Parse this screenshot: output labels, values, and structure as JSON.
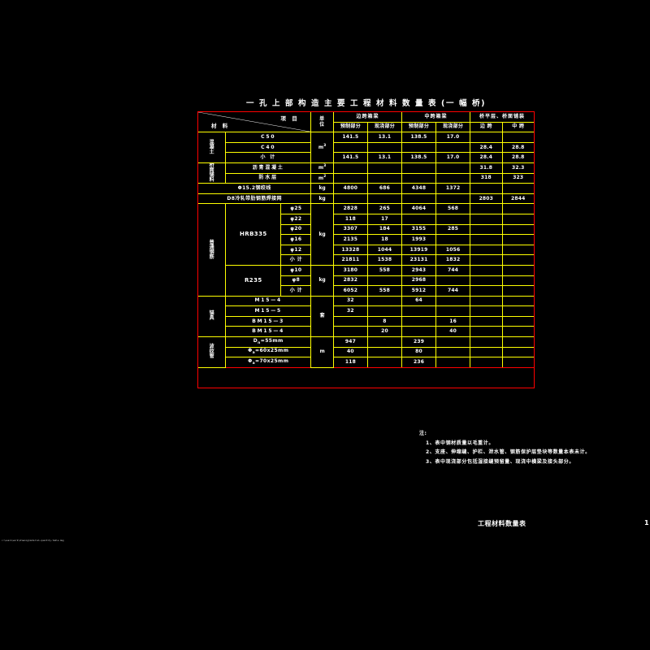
{
  "title": "一 孔 上 部 构 造 主 要 工 程 材 料 数 量 表 (一 幅 桥)",
  "header": {
    "corner_item": "项 目",
    "corner_material": "材 料",
    "unit": "单位",
    "groups": [
      {
        "label": "边跨箱梁",
        "subs": [
          "预制部分",
          "现浇部分"
        ]
      },
      {
        "label": "中跨箱梁",
        "subs": [
          "预制部分",
          "现浇部分"
        ]
      },
      {
        "label": "桥平层、桥面铺装",
        "subs": [
          "边  跨",
          "中  跨"
        ]
      }
    ]
  },
  "sections": [
    {
      "name": "混凝土",
      "rows": [
        {
          "label": "C50",
          "unit": "m³",
          "values": [
            "141.5",
            "13.1",
            "138.5",
            "17.0",
            "",
            ""
          ]
        },
        {
          "label": "C40",
          "unit": "",
          "values": [
            "",
            "",
            "",
            "",
            "28.4",
            "28.8"
          ]
        },
        {
          "label": "小    计",
          "unit": "",
          "values": [
            "141.5",
            "13.1",
            "138.5",
            "17.0",
            "28.4",
            "28.8"
          ]
        }
      ]
    },
    {
      "name": "桥面铺料",
      "rows": [
        {
          "label": "沥青混凝土",
          "unit": "m³",
          "values": [
            "",
            "",
            "",
            "",
            "31.8",
            "32.3"
          ]
        },
        {
          "label": "防水层",
          "unit": "m²",
          "values": [
            "",
            "",
            "",
            "",
            "318",
            "323"
          ]
        }
      ]
    },
    {
      "name": "",
      "rows": [
        {
          "label": "Φ15.2钢绞线",
          "unit": "kg",
          "values": [
            "4800",
            "686",
            "4348",
            "1372",
            "",
            ""
          ]
        },
        {
          "label": "D8冷轧带肋钢筋焊接网",
          "unit": "kg",
          "values": [
            "",
            "",
            "",
            "",
            "2803",
            "2844"
          ]
        }
      ]
    },
    {
      "name": "普通钢筋",
      "grade_groups": [
        {
          "grade": "HRB335",
          "unit": "kg",
          "rows": [
            {
              "label": "φ25",
              "values": [
                "2828",
                "265",
                "4064",
                "568",
                "",
                ""
              ]
            },
            {
              "label": "φ22",
              "values": [
                "118",
                "17",
                "",
                "",
                "",
                ""
              ]
            },
            {
              "label": "φ20",
              "values": [
                "3307",
                "184",
                "3155",
                "285",
                "",
                ""
              ]
            },
            {
              "label": "φ16",
              "values": [
                "2135",
                "18",
                "1993",
                "",
                "",
                ""
              ]
            },
            {
              "label": "φ12",
              "values": [
                "13328",
                "1044",
                "13919",
                "1056",
                "",
                ""
              ]
            },
            {
              "label": "小  计",
              "values": [
                "21811",
                "1538",
                "23131",
                "1832",
                "",
                ""
              ]
            }
          ]
        },
        {
          "grade": "R235",
          "unit": "kg",
          "rows": [
            {
              "label": "φ10",
              "values": [
                "3180",
                "558",
                "2943",
                "744",
                "",
                ""
              ]
            },
            {
              "label": "φ8",
              "values": [
                "2832",
                "",
                "2968",
                "",
                "",
                ""
              ]
            },
            {
              "label": "小  计",
              "values": [
                "6052",
                "558",
                "5912",
                "744",
                "",
                ""
              ]
            }
          ]
        }
      ]
    },
    {
      "name": "锚具",
      "rows": [
        {
          "label": "M15—4",
          "unit": "套",
          "values": [
            "32",
            "",
            "64",
            "",
            "",
            ""
          ]
        },
        {
          "label": "M15—5",
          "unit": "",
          "values": [
            "32",
            "",
            "",
            "",
            "",
            ""
          ]
        },
        {
          "label": "BM15—3",
          "unit": "",
          "values": [
            "",
            "8",
            "",
            "16",
            "",
            ""
          ]
        },
        {
          "label": "BM15—4",
          "unit": "",
          "values": [
            "",
            "20",
            "",
            "40",
            "",
            ""
          ]
        }
      ]
    },
    {
      "name": "波纹管",
      "rows": [
        {
          "label": "Dn=55mm",
          "unit": "m",
          "values": [
            "947",
            "",
            "239",
            "",
            "",
            ""
          ]
        },
        {
          "label": "Φa=60x25mm",
          "unit": "",
          "values": [
            "40",
            "",
            "80",
            "",
            "",
            ""
          ]
        },
        {
          "label": "Φa=70x25mm",
          "unit": "",
          "values": [
            "118",
            "",
            "236",
            "",
            "",
            ""
          ]
        }
      ]
    }
  ],
  "notes": {
    "title": "注:",
    "lines": [
      "1、表中钢材质量以毛重计。",
      "2、支座、伸缩缝、护栏、泄水管、钢筋保护层垫块等数量本表未计。",
      "3、表中现浇部分包括湿接缝预留量、现浇中横梁及接头部分。"
    ]
  },
  "footer": {
    "label": "工程材料数量表",
    "page": "1",
    "file_path": "c:\\users\\work\\drawing\\material-quantity-table.dwg"
  },
  "colors": {
    "background": "#000000",
    "frame": "#ff0000",
    "grid": "#ffff00",
    "text": "#ffffff"
  }
}
